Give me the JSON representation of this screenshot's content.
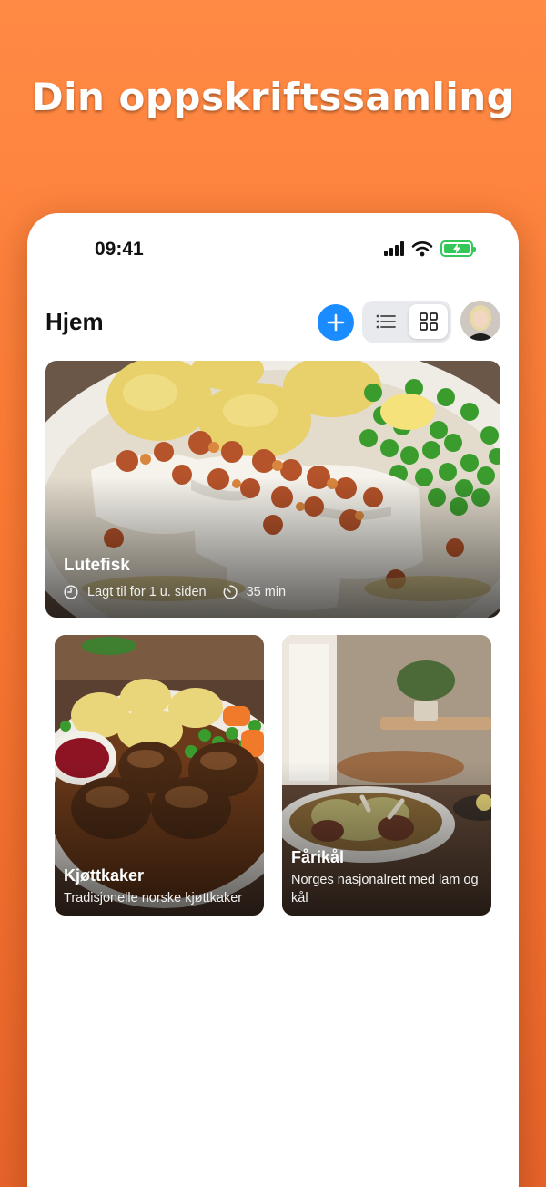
{
  "headline": "Din oppskriftssamling",
  "status_bar": {
    "time": "09:41",
    "icons": [
      "signal-icon",
      "wifi-icon",
      "battery-charging-icon"
    ]
  },
  "header": {
    "title": "Hjem",
    "add_icon": "plus-icon",
    "view_toggle": {
      "options": [
        "list-view-icon",
        "grid-view-icon"
      ],
      "selected": "grid-view-icon"
    },
    "avatar": "profile-avatar"
  },
  "recipes": [
    {
      "title": "Lutefisk",
      "added": "Lagt til for 1 u. siden",
      "time": "35 min"
    },
    {
      "title": "Kjøttkaker",
      "description": "Tradisjonelle norske kjøttkaker"
    },
    {
      "title": "Fårikål",
      "description": "Norges nasjonalrett med lam og kål"
    }
  ],
  "colors": {
    "accent": "#1a8cff",
    "background": "#fb7a33",
    "battery": "#34c759"
  }
}
